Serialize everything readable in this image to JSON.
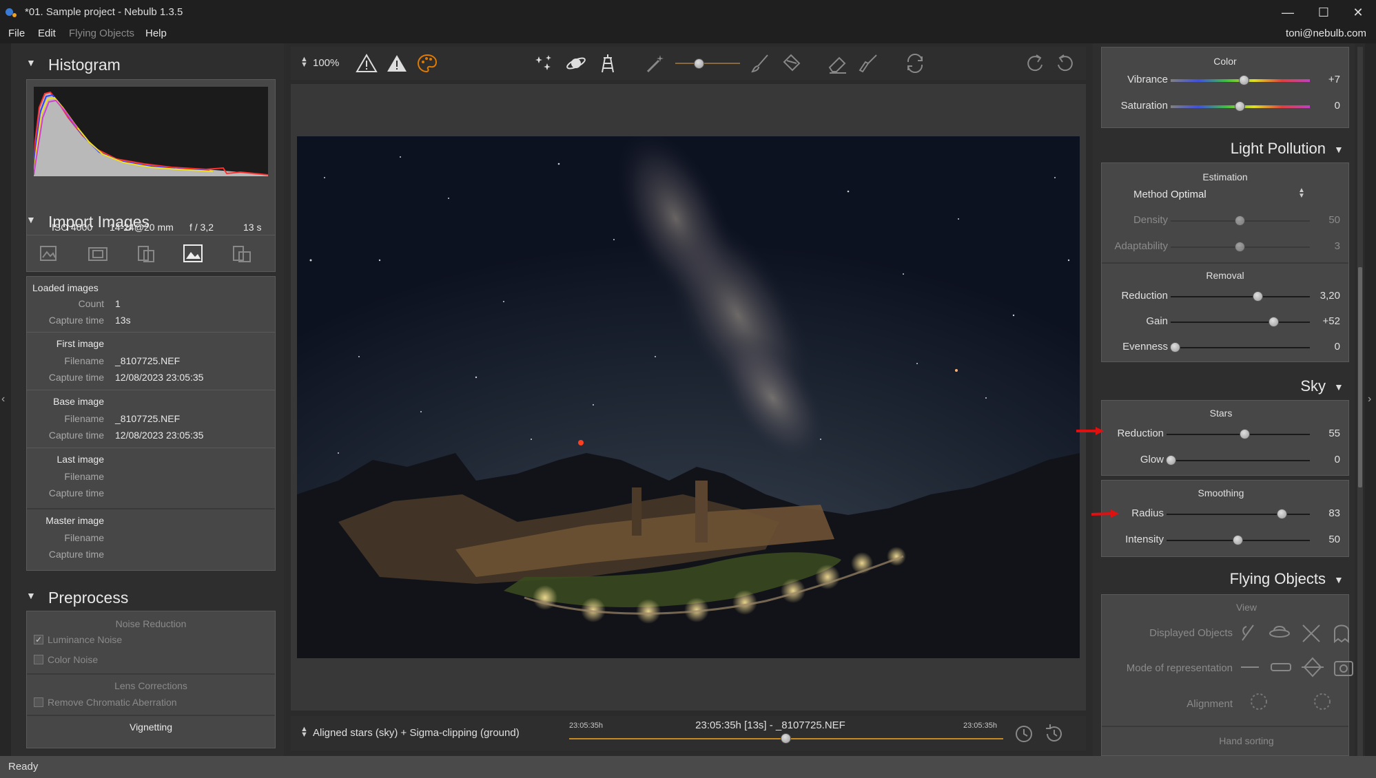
{
  "window": {
    "title": "*01. Sample project - Nebulb 1.3.5",
    "minimize": "—",
    "maximize": "☐",
    "close": "✕"
  },
  "menu": {
    "file": "File",
    "edit": "Edit",
    "flying_objects": "Flying Objects",
    "help": "Help",
    "user": "toni@nebulb.com"
  },
  "histogram": {
    "title": "Histogram",
    "iso": "ISO 4000",
    "lens": "14-24@20 mm",
    "aperture": "f / 3,2",
    "exposure": "13 s"
  },
  "import_images": {
    "title": "Import Images",
    "loaded": {
      "heading": "Loaded images",
      "count_label": "Count",
      "count": "1",
      "capture_label": "Capture time",
      "capture": "13s"
    },
    "first": {
      "heading": "First image",
      "filename_label": "Filename",
      "filename": "_8107725.NEF",
      "capture_label": "Capture time",
      "capture": "12/08/2023 23:05:35"
    },
    "base": {
      "heading": "Base image",
      "filename_label": "Filename",
      "filename": "_8107725.NEF",
      "capture_label": "Capture time",
      "capture": "12/08/2023 23:05:35"
    },
    "last": {
      "heading": "Last image",
      "filename_label": "Filename",
      "capture_label": "Capture time"
    },
    "master": {
      "heading": "Master image",
      "filename_label": "Filename",
      "capture_label": "Capture time"
    }
  },
  "preprocess": {
    "title": "Preprocess",
    "noise_reduction": "Noise Reduction",
    "luminance_noise": "Luminance Noise",
    "color_noise": "Color Noise",
    "lens_corrections": "Lens Corrections",
    "remove_ca": "Remove Chromatic Aberration",
    "vignetting": "Vignetting"
  },
  "toolbar": {
    "zoom": "100%"
  },
  "bottombar": {
    "mode": "Aligned stars (sky) + Sigma-clipping (ground)",
    "time_start": "23:05:35h",
    "time_center": "23:05:35h [13s] - _8107725.NEF",
    "time_end": "23:05:35h",
    "timeline_position": 0.5
  },
  "right": {
    "color": {
      "heading": "Color",
      "vibrance_label": "Vibrance",
      "vibrance": "+7",
      "vibrance_pos": 0.53,
      "saturation_label": "Saturation",
      "saturation": "0",
      "saturation_pos": 0.5
    },
    "light_pollution": {
      "title": "Light Pollution",
      "estimation": "Estimation",
      "method_label": "Method",
      "method": "Optimal",
      "density_label": "Density",
      "density": "50",
      "density_pos": 0.5,
      "adaptability_label": "Adaptability",
      "adaptability": "3",
      "adaptability_pos": 0.5,
      "removal": "Removal",
      "reduction_label": "Reduction",
      "reduction": "3,20",
      "reduction_pos": 0.64,
      "gain_label": "Gain",
      "gain": "+52",
      "gain_pos": 0.76,
      "evenness_label": "Evenness",
      "evenness": "0",
      "evenness_pos": 0.0
    },
    "sky": {
      "title": "Sky",
      "stars": "Stars",
      "reduction_label": "Reduction",
      "reduction": "55",
      "reduction_pos": 0.55,
      "glow_label": "Glow",
      "glow": "0",
      "glow_pos": 0.0,
      "smoothing": "Smoothing",
      "radius_label": "Radius",
      "radius": "83",
      "radius_pos": 0.83,
      "intensity_label": "Intensity",
      "intensity": "50",
      "intensity_pos": 0.5
    },
    "flying_objects": {
      "title": "Flying Objects",
      "view": "View",
      "displayed_objects": "Displayed Objects",
      "mode_repr": "Mode of representation",
      "alignment": "Alignment",
      "hand_sorting": "Hand sorting"
    }
  },
  "status": {
    "text": "Ready"
  },
  "colors": {
    "accent": "#e07b00",
    "arrow": "#e01010"
  }
}
